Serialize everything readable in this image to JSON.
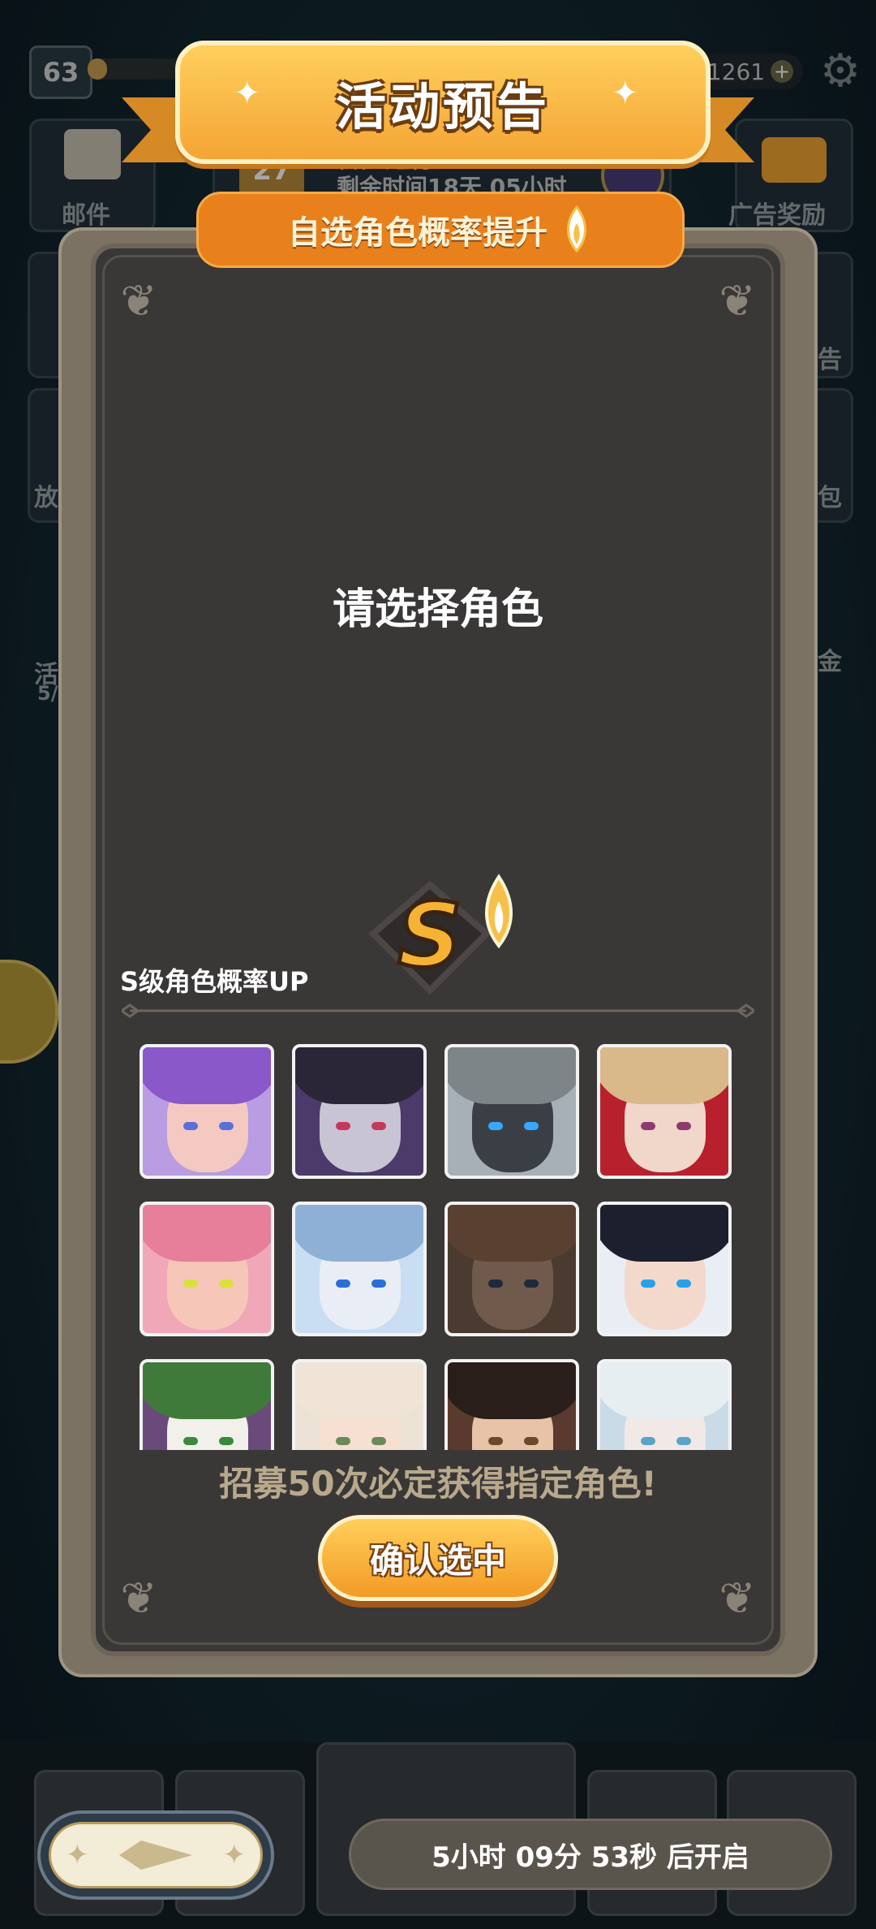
{
  "hud": {
    "level": "63",
    "coins": "11261",
    "plus": "+"
  },
  "background": {
    "mail_label": "邮件",
    "ad_reward_label": "广告奖励",
    "pass_badge": "27",
    "pass_title": "冒险通行证",
    "pass_remaining": "剩余时间18天 05小时",
    "left_fragments": [
      "放",
      "活",
      "5/"
    ],
    "right_fragments": [
      "告",
      "包",
      "金"
    ]
  },
  "banner": {
    "title": "活动预告",
    "subtitle": "自选角色概率提升"
  },
  "panel": {
    "prompt": "请选择角色",
    "s_rank_label": "S级角色概率UP",
    "s_badge_letter": "S",
    "pity_text": "招募50次必定获得指定角色!",
    "confirm_label": "确认选中"
  },
  "characters": [
    {
      "hair": "#8a58c9",
      "face": "#f3c9c2",
      "eyes": "#5a6fd8",
      "bg": "#b99ce2"
    },
    {
      "hair": "#2a2638",
      "face": "#c9c4d4",
      "eyes": "#c23a5a",
      "bg": "#4b3a6a"
    },
    {
      "hair": "#7e8589",
      "face": "#3a3f46",
      "eyes": "#3aa7ff",
      "bg": "#a7b0b6"
    },
    {
      "hair": "#d9b98a",
      "face": "#f0d7c9",
      "eyes": "#8e3a6e",
      "bg": "#b8202e"
    },
    {
      "hair": "#e77f9a",
      "face": "#f6c6b8",
      "eyes": "#d9e23a",
      "bg": "#f0a8b8"
    },
    {
      "hair": "#8fb0d6",
      "face": "#e9eef6",
      "eyes": "#2a6fd8",
      "bg": "#c9def2"
    },
    {
      "hair": "#5a4030",
      "face": "#6f5a4b",
      "eyes": "#1e2a3a",
      "bg": "#4a3a30"
    },
    {
      "hair": "#1c1f2e",
      "face": "#f3d9cc",
      "eyes": "#2aa0e6",
      "bg": "#e9eef4"
    },
    {
      "hair": "#3f7a3a",
      "face": "#f2f0ea",
      "eyes": "#3a8a3a",
      "bg": "#6a4a7a"
    },
    {
      "hair": "#efe4d6",
      "face": "#f6e0d2",
      "eyes": "#6b8a5a",
      "bg": "#ece2d6"
    },
    {
      "hair": "#2a1e1a",
      "face": "#e8c3a8",
      "eyes": "#6b4a2a",
      "bg": "#5a3a2e"
    },
    {
      "hair": "#e6eef2",
      "face": "#f2e8e6",
      "eyes": "#5aa3c9",
      "bg": "#c9dbe6"
    }
  ],
  "bottom": {
    "countdown": "5小时 09分 53秒 后开启"
  },
  "icons": {
    "settings": "gear-icon",
    "rocket": "rocket-icon",
    "sparkle": "sparkle-icon"
  },
  "colors": {
    "banner_orange": "#f4a535",
    "panel_bg": "#3a3737",
    "confirm_orange": "#f39b26"
  }
}
